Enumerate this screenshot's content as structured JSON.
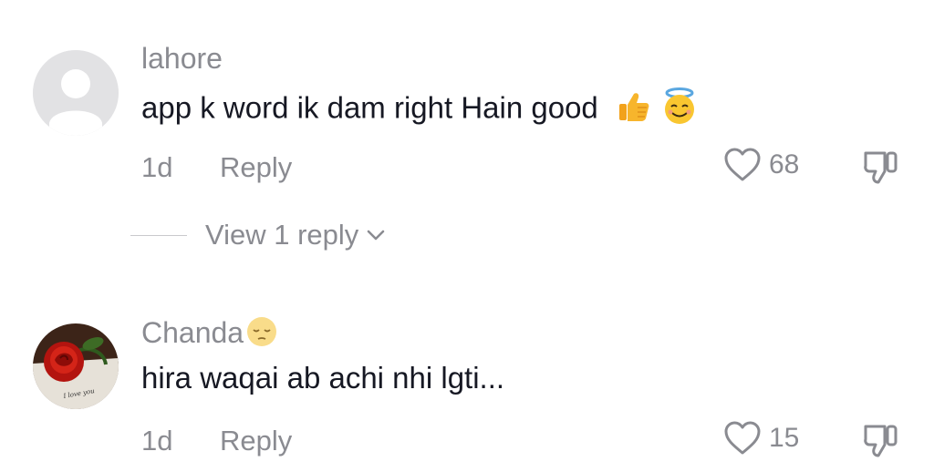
{
  "comments": [
    {
      "username": "lahore",
      "text": "app k word ik dam right Hain good",
      "emojis": [
        "thumbs-up-emoji",
        "smiling-face-with-halo-emoji"
      ],
      "time": "1d",
      "reply_label": "Reply",
      "likes": "68",
      "avatar": "default-avatar-icon",
      "view_replies": "View 1 reply"
    },
    {
      "username": "Chanda",
      "username_emoji": "pensive-face-emoji",
      "text": "hira waqai ab achi nhi lgti...",
      "time": "1d",
      "reply_label": "Reply",
      "likes": "15",
      "avatar": "rose-photo-avatar",
      "avatar_caption": "I love you"
    }
  ],
  "colors": {
    "secondary_text": "#8a8b91",
    "primary_text": "#161823",
    "avatar_bg": "#e4e4e6"
  }
}
